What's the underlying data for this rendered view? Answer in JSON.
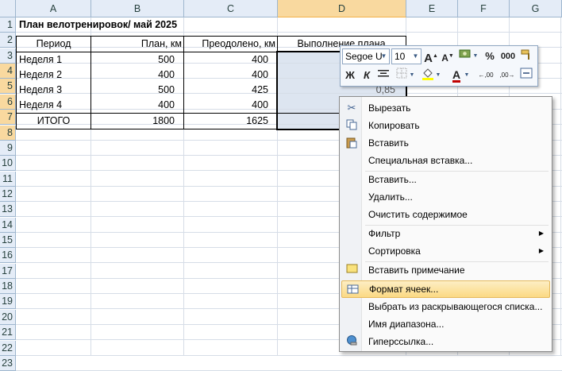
{
  "columns": [
    "A",
    "B",
    "C",
    "D",
    "E",
    "F",
    "G"
  ],
  "rows": [
    "1",
    "2",
    "3",
    "4",
    "5",
    "6",
    "7",
    "8",
    "9",
    "10",
    "11",
    "12",
    "13",
    "14",
    "15",
    "16",
    "17",
    "18",
    "19",
    "20",
    "21",
    "22",
    "23"
  ],
  "title": "План велотренировок/ май 2025",
  "table": {
    "headers": [
      "Период",
      "План, км",
      "Преодолено, км",
      "Выполнение плана"
    ],
    "rows": [
      [
        "Неделя 1",
        "500",
        "400",
        ""
      ],
      [
        "Неделя 2",
        "400",
        "400",
        ""
      ],
      [
        "Неделя 3",
        "500",
        "425",
        "0,85"
      ],
      [
        "Неделя 4",
        "400",
        "400",
        ""
      ]
    ],
    "total": [
      "ИТОГО",
      "1800",
      "1625",
      ""
    ]
  },
  "mini_toolbar": {
    "font_name": "Segoe U",
    "font_size": "10",
    "grow_font": "A",
    "shrink_font": "A",
    "percent": "%",
    "thousands": "000",
    "bold": "Ж",
    "italic": "К",
    "font_color_letter": "A",
    "decrease_decimal": "←,00",
    "increase_decimal": ",00→"
  },
  "context_menu": [
    {
      "label": "Вырезать",
      "icon": "scissors-icon"
    },
    {
      "label": "Копировать",
      "icon": "copy-icon"
    },
    {
      "label": "Вставить",
      "icon": "paste-icon"
    },
    {
      "label": "Специальная вставка...",
      "icon": ""
    },
    {
      "label": "Вставить...",
      "icon": ""
    },
    {
      "label": "Удалить...",
      "icon": ""
    },
    {
      "label": "Очистить содержимое",
      "icon": ""
    },
    {
      "label": "Фильтр",
      "icon": "",
      "submenu": true
    },
    {
      "label": "Сортировка",
      "icon": "",
      "submenu": true
    },
    {
      "label": "Вставить примечание",
      "icon": "comment-icon"
    },
    {
      "label": "Формат ячеек...",
      "icon": "format-cells-icon",
      "highlighted": true
    },
    {
      "label": "Выбрать из раскрывающегося списка...",
      "icon": ""
    },
    {
      "label": "Имя диапазона...",
      "icon": ""
    },
    {
      "label": "Гиперссылка...",
      "icon": "hyperlink-icon"
    }
  ],
  "colors": {
    "header_bg": "#e4ecf7",
    "selected_header_bg": "#f9d99f",
    "selection_fill": "#dde5f0",
    "menu_highlight": "#fbd983"
  }
}
